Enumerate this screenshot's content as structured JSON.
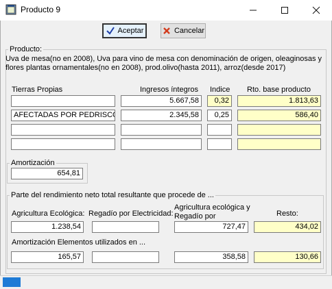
{
  "window": {
    "title": "Producto 9"
  },
  "toolbar": {
    "accept_label": "Aceptar",
    "cancel_label": "Cancelar"
  },
  "producto": {
    "legend": "Producto:",
    "description": "Uva de mesa(no en 2008), Uva para vino de mesa con denominación de origen, oleaginosas y flores plantas ornamentales(no en 2008), prod.olivo(hasta 2011), arroz(desde 2017)",
    "headers": {
      "tierras": "Tierras Propias",
      "ingresos": "Ingresos íntegros",
      "indice": "Indice",
      "rto": "Rto. base producto"
    },
    "rows": [
      {
        "tierras": "",
        "ingresos": "5.667,58",
        "indice": "0,32",
        "rto": "1.813,63"
      },
      {
        "tierras": "AFECTADAS POR PEDRISCO",
        "ingresos": "2.345,58",
        "indice": "0,25",
        "rto": "586,40"
      },
      {
        "tierras": "",
        "ingresos": "",
        "indice": "",
        "rto": ""
      },
      {
        "tierras": "",
        "ingresos": "",
        "indice": "",
        "rto": ""
      }
    ]
  },
  "amortizacion": {
    "legend": "Amortización",
    "value": "654,81"
  },
  "parte": {
    "legend": "Parte del rendimiento neto total resultante que procede de ...",
    "labels": {
      "eco": "Agricultura Ecológica:",
      "regadio": "Regadío por Electricidad:",
      "eco_regadio": "Agricultura ecológica y Regadío por electricidad:",
      "resto": "Resto:",
      "amort_elementos": "Amortización Elementos utilizados en ..."
    },
    "row1": {
      "eco": "1.238,54",
      "regadio": "",
      "eco_regadio": "727,47",
      "resto": "434,02"
    },
    "row2": {
      "eco": "165,57",
      "regadio": "",
      "eco_regadio": "358,58",
      "resto": "130,66"
    }
  },
  "colors": {
    "highlight": "#ffffc8",
    "status_indicator": "#1e7bd6"
  },
  "icons": {
    "app": "app-window-icon",
    "accept": "checkmark-icon",
    "cancel": "x-icon"
  }
}
